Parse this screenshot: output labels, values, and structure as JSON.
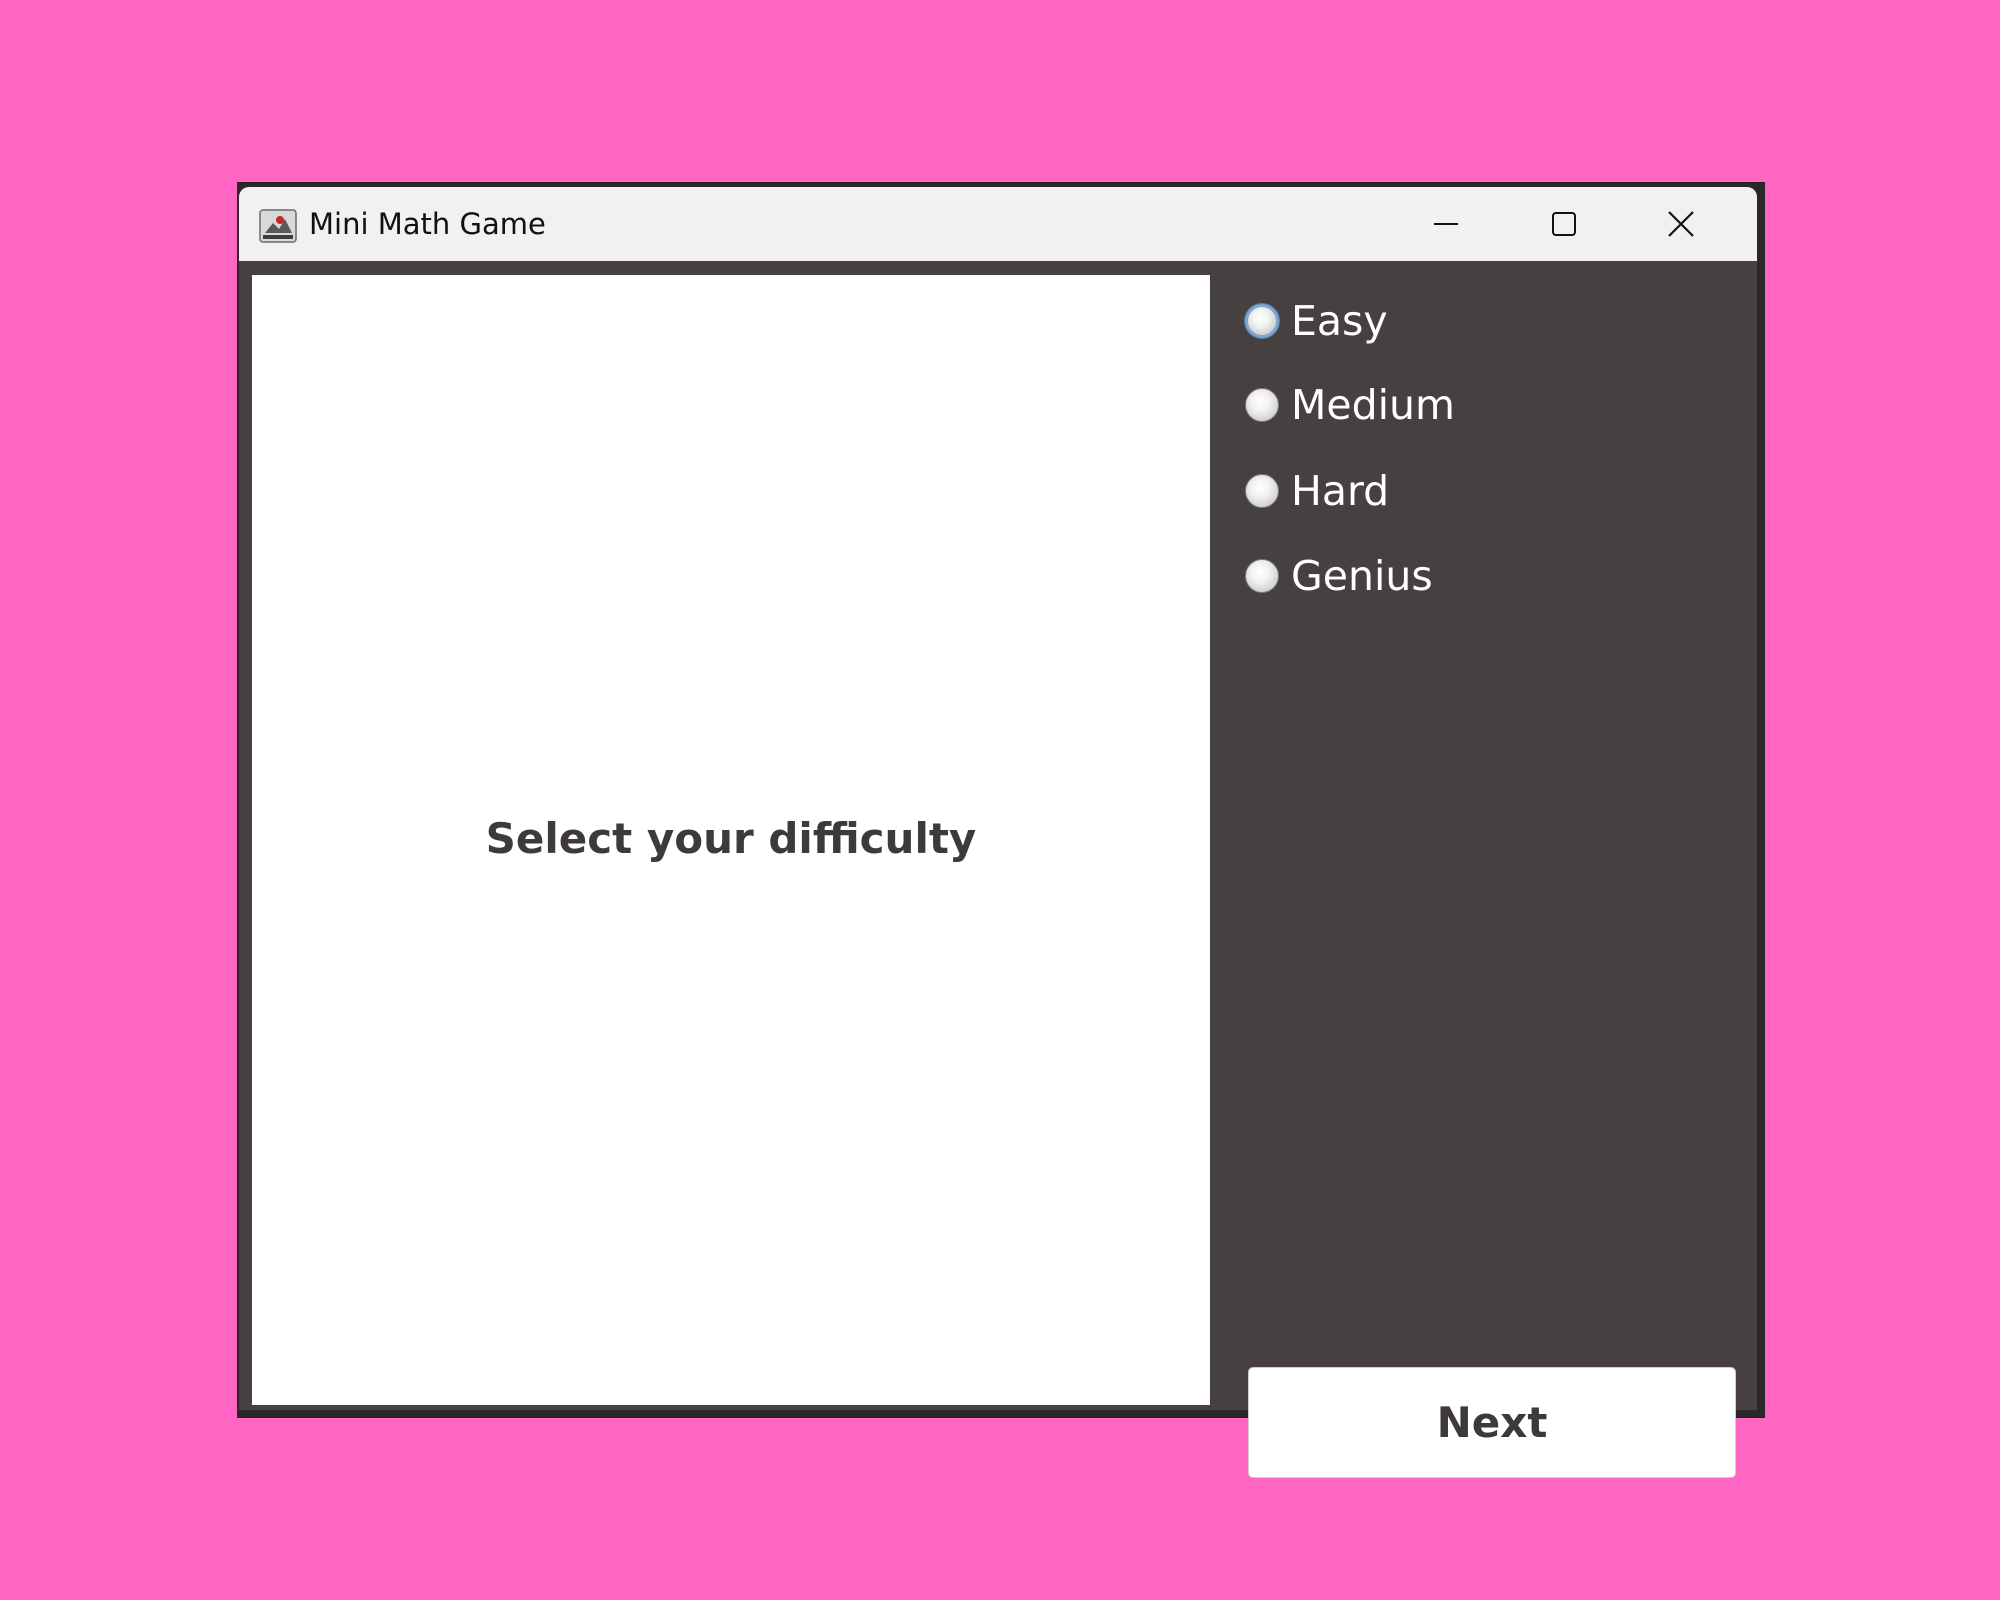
{
  "window": {
    "title": "Mini Math Game",
    "controls": {
      "minimize": "minimize-icon",
      "maximize": "maximize-icon",
      "close": "close-icon"
    }
  },
  "main": {
    "prompt": "Select your difficulty"
  },
  "difficulty": {
    "options": [
      {
        "label": "Easy",
        "selected": false,
        "focused": true
      },
      {
        "label": "Medium",
        "selected": false,
        "focused": false
      },
      {
        "label": "Hard",
        "selected": false,
        "focused": false
      },
      {
        "label": "Genius",
        "selected": false,
        "focused": false
      }
    ]
  },
  "actions": {
    "next_label": "Next"
  },
  "colors": {
    "desktop_background": "#ff66c4",
    "panel_background": "#474041",
    "title_bar": "#f1f1f1",
    "text_dark": "#3e3a3a",
    "text_light": "#ffffff"
  }
}
